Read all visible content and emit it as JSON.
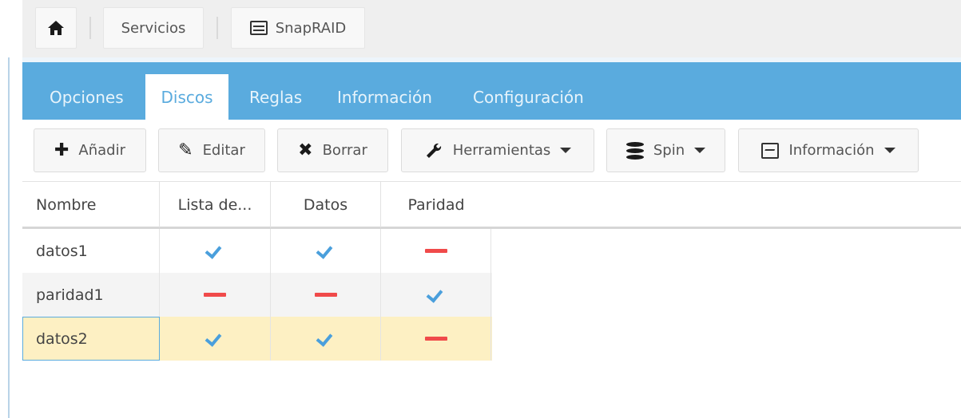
{
  "breadcrumb": {
    "home_icon": "home-icon",
    "items": [
      "Servicios",
      "SnapRAID"
    ],
    "snapraid_icon": "disk-array-icon"
  },
  "tabs": [
    "Opciones",
    "Discos",
    "Reglas",
    "Información",
    "Configuración"
  ],
  "active_tab": "Discos",
  "toolbar": {
    "add": "Añadir",
    "edit": "Editar",
    "delete": "Borrar",
    "tools": "Herramientas",
    "spin": "Spin",
    "info": "Información"
  },
  "grid": {
    "columns": [
      "Nombre",
      "Lista de...",
      "Datos",
      "Paridad"
    ],
    "rows": [
      {
        "name": "datos1",
        "content": true,
        "data": true,
        "parity": false
      },
      {
        "name": "paridad1",
        "content": false,
        "data": false,
        "parity": true
      },
      {
        "name": "datos2",
        "content": true,
        "data": true,
        "parity": false
      }
    ],
    "selected_row": 2
  },
  "colors": {
    "accent": "#5aabde",
    "check": "#4a9fdc",
    "cross": "#f04a4a",
    "selected_row": "#fdf0c3"
  }
}
